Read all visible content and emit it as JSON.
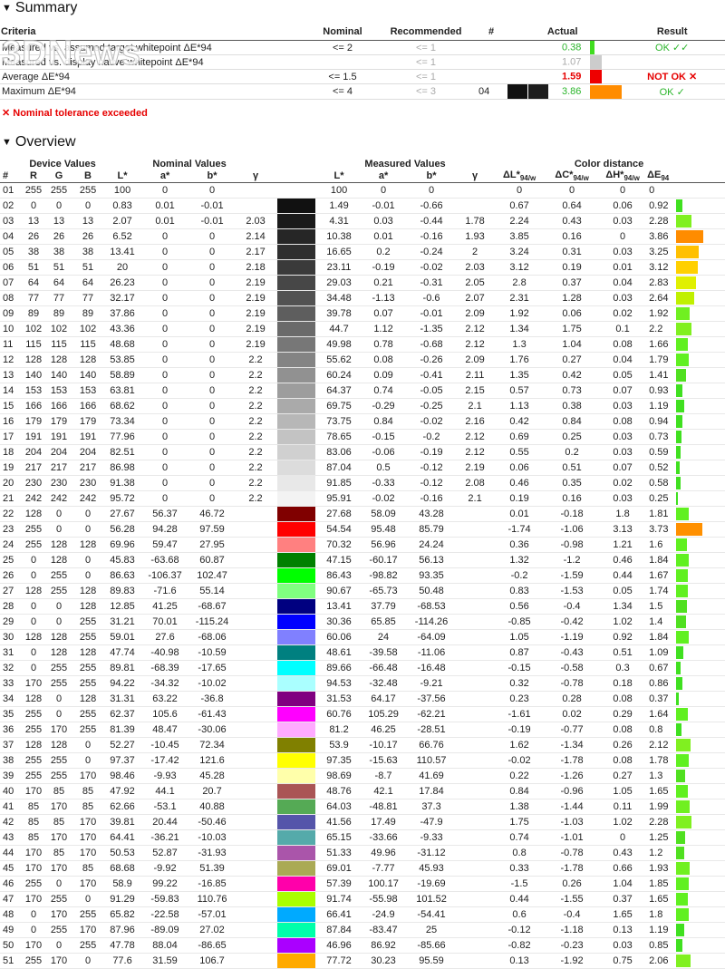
{
  "summary": {
    "title": "Summary",
    "headers": {
      "criteria": "Criteria",
      "nominal": "Nominal",
      "recommended": "Recommended",
      "hash": "#",
      "actual": "Actual",
      "result": "Result"
    },
    "rows": [
      {
        "criteria": "Measured vs. assumed target whitepoint ΔE*94",
        "nominal": "<= 2",
        "recommended": "<= 1",
        "num": "",
        "actual": "0.38",
        "actual_class": "grn",
        "bar_color": "#40dd20",
        "bar_w": "5",
        "result": "OK ✓✓",
        "result_class": "grn"
      },
      {
        "criteria": "Measured vs. display native whitepoint ΔE*94",
        "nominal": "",
        "recommended": "<= 1",
        "num": "",
        "actual": "1.07",
        "actual_class": "gry",
        "bar_color": "#cccccc",
        "bar_w": "13",
        "result": "",
        "result_class": ""
      },
      {
        "criteria": "Average ΔE*94",
        "nominal": "<= 1.5",
        "recommended": "<= 1",
        "num": "",
        "actual": "1.59",
        "actual_class": "red",
        "bar_color": "#ee0000",
        "bar_w": "13",
        "result": "NOT OK ✕",
        "result_class": "red"
      },
      {
        "criteria": "Maximum ΔE*94",
        "nominal": "<= 4",
        "recommended": "<= 3",
        "num": "04",
        "actual": "3.86",
        "actual_class": "grn",
        "bar_color": "#ff8c00",
        "bar_w": "35",
        "result": "OK ✓",
        "result_class": "grn"
      }
    ],
    "watermark": "3DNews"
  },
  "warning": "✕ Nominal tolerance exceeded",
  "overview": {
    "title": "Overview",
    "group_headers": {
      "device": "Device Values",
      "nominal": "Nominal Values",
      "measured": "Measured Values",
      "distance": "Color distance"
    },
    "col_headers": {
      "num": "#",
      "r": "R",
      "g": "G",
      "b": "B",
      "L": "L*",
      "a": "a*",
      "bb": "b*",
      "gamma": "γ",
      "mL": "L*",
      "ma": "a*",
      "mb": "b*",
      "mgamma": "γ",
      "dL": "ΔL*",
      "dC": "ΔC*",
      "dH": "ΔH*",
      "sub": "94/w",
      "de": "ΔE",
      "de_sub": "94"
    },
    "rows": [
      [
        "01",
        "255",
        "255",
        "255",
        "100",
        "0",
        "0",
        "",
        "#ffffff",
        "100",
        "0",
        "0",
        "",
        "0",
        "0",
        "0",
        "0",
        "#ffffff",
        0
      ],
      [
        "02",
        "0",
        "0",
        "0",
        "0.83",
        "0.01",
        "-0.01",
        "",
        "#111111",
        "1.49",
        "-0.01",
        "-0.66",
        "",
        "0.67",
        "0.64",
        "0.06",
        "0.92",
        "#40e020",
        7
      ],
      [
        "03",
        "13",
        "13",
        "13",
        "2.07",
        "0.01",
        "-0.01",
        "2.03",
        "#1a1a1a",
        "4.31",
        "0.03",
        "-0.44",
        "1.78",
        "2.24",
        "0.43",
        "0.03",
        "2.28",
        "#80f020",
        17
      ],
      [
        "04",
        "26",
        "26",
        "26",
        "6.52",
        "0",
        "0",
        "2.14",
        "#262626",
        "10.38",
        "0.01",
        "-0.16",
        "1.93",
        "3.85",
        "0.16",
        "0",
        "3.86",
        "#ff8c00",
        30
      ],
      [
        "05",
        "38",
        "38",
        "38",
        "13.41",
        "0",
        "0",
        "2.17",
        "#2f2f2f",
        "16.65",
        "0.2",
        "-0.24",
        "2",
        "3.24",
        "0.31",
        "0.03",
        "3.25",
        "#ffc000",
        25
      ],
      [
        "06",
        "51",
        "51",
        "51",
        "20",
        "0",
        "0",
        "2.18",
        "#3a3a3a",
        "23.11",
        "-0.19",
        "-0.02",
        "2.03",
        "3.12",
        "0.19",
        "0.01",
        "3.12",
        "#ffd000",
        24
      ],
      [
        "07",
        "64",
        "64",
        "64",
        "26.23",
        "0",
        "0",
        "2.19",
        "#474747",
        "29.03",
        "0.21",
        "-0.31",
        "2.05",
        "2.8",
        "0.37",
        "0.04",
        "2.83",
        "#e0f000",
        22
      ],
      [
        "08",
        "77",
        "77",
        "77",
        "32.17",
        "0",
        "0",
        "2.19",
        "#525252",
        "34.48",
        "-1.13",
        "-0.6",
        "2.07",
        "2.31",
        "1.28",
        "0.03",
        "2.64",
        "#c0f000",
        20
      ],
      [
        "09",
        "89",
        "89",
        "89",
        "37.86",
        "0",
        "0",
        "2.19",
        "#5e5e5e",
        "39.78",
        "0.07",
        "-0.01",
        "2.09",
        "1.92",
        "0.06",
        "0.02",
        "1.92",
        "#70f020",
        15
      ],
      [
        "10",
        "102",
        "102",
        "102",
        "43.36",
        "0",
        "0",
        "2.19",
        "#6a6a6a",
        "44.7",
        "1.12",
        "-1.35",
        "2.12",
        "1.34",
        "1.75",
        "0.1",
        "2.2",
        "#80f020",
        17
      ],
      [
        "11",
        "115",
        "115",
        "115",
        "48.68",
        "0",
        "0",
        "2.19",
        "#777777",
        "49.98",
        "0.78",
        "-0.68",
        "2.12",
        "1.3",
        "1.04",
        "0.08",
        "1.66",
        "#60f020",
        13
      ],
      [
        "12",
        "128",
        "128",
        "128",
        "53.85",
        "0",
        "0",
        "2.2",
        "#848484",
        "55.62",
        "0.08",
        "-0.26",
        "2.09",
        "1.76",
        "0.27",
        "0.04",
        "1.79",
        "#60f020",
        14
      ],
      [
        "13",
        "140",
        "140",
        "140",
        "58.89",
        "0",
        "0",
        "2.2",
        "#919191",
        "60.24",
        "0.09",
        "-0.41",
        "2.11",
        "1.35",
        "0.42",
        "0.05",
        "1.41",
        "#50e020",
        11
      ],
      [
        "14",
        "153",
        "153",
        "153",
        "63.81",
        "0",
        "0",
        "2.2",
        "#9d9d9d",
        "64.37",
        "0.74",
        "-0.05",
        "2.15",
        "0.57",
        "0.73",
        "0.07",
        "0.93",
        "#40e020",
        7
      ],
      [
        "15",
        "166",
        "166",
        "166",
        "68.62",
        "0",
        "0",
        "2.2",
        "#aaaaaa",
        "69.75",
        "-0.29",
        "-0.25",
        "2.1",
        "1.13",
        "0.38",
        "0.03",
        "1.19",
        "#40e020",
        9
      ],
      [
        "16",
        "179",
        "179",
        "179",
        "73.34",
        "0",
        "0",
        "2.2",
        "#b7b7b7",
        "73.75",
        "0.84",
        "-0.02",
        "2.16",
        "0.42",
        "0.84",
        "0.08",
        "0.94",
        "#40e020",
        7
      ],
      [
        "17",
        "191",
        "191",
        "191",
        "77.96",
        "0",
        "0",
        "2.2",
        "#c3c3c3",
        "78.65",
        "-0.15",
        "-0.2",
        "2.12",
        "0.69",
        "0.25",
        "0.03",
        "0.73",
        "#40e020",
        6
      ],
      [
        "18",
        "204",
        "204",
        "204",
        "82.51",
        "0",
        "0",
        "2.2",
        "#d0d0d0",
        "83.06",
        "-0.06",
        "-0.19",
        "2.12",
        "0.55",
        "0.2",
        "0.03",
        "0.59",
        "#40e020",
        5
      ],
      [
        "19",
        "217",
        "217",
        "217",
        "86.98",
        "0",
        "0",
        "2.2",
        "#dcdcdc",
        "87.04",
        "0.5",
        "-0.12",
        "2.19",
        "0.06",
        "0.51",
        "0.07",
        "0.52",
        "#40e020",
        4
      ],
      [
        "20",
        "230",
        "230",
        "230",
        "91.38",
        "0",
        "0",
        "2.2",
        "#e8e8e8",
        "91.85",
        "-0.33",
        "-0.12",
        "2.08",
        "0.46",
        "0.35",
        "0.02",
        "0.58",
        "#40e020",
        5
      ],
      [
        "21",
        "242",
        "242",
        "242",
        "95.72",
        "0",
        "0",
        "2.2",
        "#f3f3f3",
        "95.91",
        "-0.02",
        "-0.16",
        "2.1",
        "0.19",
        "0.16",
        "0.03",
        "0.25",
        "#40e020",
        2
      ],
      [
        "22",
        "128",
        "0",
        "0",
        "27.67",
        "56.37",
        "46.72",
        "",
        "#800000",
        "27.68",
        "58.09",
        "43.28",
        "",
        "0.01",
        "-0.18",
        "1.8",
        "1.81",
        "#60f020",
        14
      ],
      [
        "23",
        "255",
        "0",
        "0",
        "56.28",
        "94.28",
        "97.59",
        "",
        "#ff0000",
        "54.54",
        "95.48",
        "85.79",
        "",
        "-1.74",
        "-1.06",
        "3.13",
        "3.73",
        "#ff9000",
        29
      ],
      [
        "24",
        "255",
        "128",
        "128",
        "69.96",
        "59.47",
        "27.95",
        "",
        "#ff8080",
        "70.32",
        "56.96",
        "24.24",
        "",
        "0.36",
        "-0.98",
        "1.21",
        "1.6",
        "#60f020",
        12
      ],
      [
        "25",
        "0",
        "128",
        "0",
        "45.83",
        "-63.68",
        "60.87",
        "",
        "#008000",
        "47.15",
        "-60.17",
        "56.13",
        "",
        "1.32",
        "-1.2",
        "0.46",
        "1.84",
        "#60f020",
        14
      ],
      [
        "26",
        "0",
        "255",
        "0",
        "86.63",
        "-106.37",
        "102.47",
        "",
        "#00ff00",
        "86.43",
        "-98.82",
        "93.35",
        "",
        "-0.2",
        "-1.59",
        "0.44",
        "1.67",
        "#60f020",
        13
      ],
      [
        "27",
        "128",
        "255",
        "128",
        "89.83",
        "-71.6",
        "55.14",
        "",
        "#80ff80",
        "90.67",
        "-65.73",
        "50.48",
        "",
        "0.83",
        "-1.53",
        "0.05",
        "1.74",
        "#60f020",
        13
      ],
      [
        "28",
        "0",
        "0",
        "128",
        "12.85",
        "41.25",
        "-68.67",
        "",
        "#000080",
        "13.41",
        "37.79",
        "-68.53",
        "",
        "0.56",
        "-0.4",
        "1.34",
        "1.5",
        "#50e020",
        12
      ],
      [
        "29",
        "0",
        "0",
        "255",
        "31.21",
        "70.01",
        "-115.24",
        "",
        "#0000ff",
        "30.36",
        "65.85",
        "-114.26",
        "",
        "-0.85",
        "-0.42",
        "1.02",
        "1.4",
        "#50e020",
        11
      ],
      [
        "30",
        "128",
        "128",
        "255",
        "59.01",
        "27.6",
        "-68.06",
        "",
        "#8080ff",
        "60.06",
        "24",
        "-64.09",
        "",
        "1.05",
        "-1.19",
        "0.92",
        "1.84",
        "#60f020",
        14
      ],
      [
        "31",
        "0",
        "128",
        "128",
        "47.74",
        "-40.98",
        "-10.59",
        "",
        "#008080",
        "48.61",
        "-39.58",
        "-11.06",
        "",
        "0.87",
        "-0.43",
        "0.51",
        "1.09",
        "#40e020",
        8
      ],
      [
        "32",
        "0",
        "255",
        "255",
        "89.81",
        "-68.39",
        "-17.65",
        "",
        "#00ffff",
        "89.66",
        "-66.48",
        "-16.48",
        "",
        "-0.15",
        "-0.58",
        "0.3",
        "0.67",
        "#40e020",
        5
      ],
      [
        "33",
        "170",
        "255",
        "255",
        "94.22",
        "-34.32",
        "-10.02",
        "",
        "#aaffff",
        "94.53",
        "-32.48",
        "-9.21",
        "",
        "0.32",
        "-0.78",
        "0.18",
        "0.86",
        "#40e020",
        7
      ],
      [
        "34",
        "128",
        "0",
        "128",
        "31.31",
        "63.22",
        "-36.8",
        "",
        "#800080",
        "31.53",
        "64.17",
        "-37.56",
        "",
        "0.23",
        "0.28",
        "0.08",
        "0.37",
        "#40e020",
        3
      ],
      [
        "35",
        "255",
        "0",
        "255",
        "62.37",
        "105.6",
        "-61.43",
        "",
        "#ff00ff",
        "60.76",
        "105.29",
        "-62.21",
        "",
        "-1.61",
        "0.02",
        "0.29",
        "1.64",
        "#60f020",
        13
      ],
      [
        "36",
        "255",
        "170",
        "255",
        "81.39",
        "48.47",
        "-30.06",
        "",
        "#ffaaff",
        "81.2",
        "46.25",
        "-28.51",
        "",
        "-0.19",
        "-0.77",
        "0.08",
        "0.8",
        "#40e020",
        6
      ],
      [
        "37",
        "128",
        "128",
        "0",
        "52.27",
        "-10.45",
        "72.34",
        "",
        "#808000",
        "53.9",
        "-10.17",
        "66.76",
        "",
        "1.62",
        "-1.34",
        "0.26",
        "2.12",
        "#80f020",
        16
      ],
      [
        "38",
        "255",
        "255",
        "0",
        "97.37",
        "-17.42",
        "121.6",
        "",
        "#ffff00",
        "97.35",
        "-15.63",
        "110.57",
        "",
        "-0.02",
        "-1.78",
        "0.08",
        "1.78",
        "#60f020",
        14
      ],
      [
        "39",
        "255",
        "255",
        "170",
        "98.46",
        "-9.93",
        "45.28",
        "",
        "#ffffaa",
        "98.69",
        "-8.7",
        "41.69",
        "",
        "0.22",
        "-1.26",
        "0.27",
        "1.3",
        "#50e020",
        10
      ],
      [
        "40",
        "170",
        "85",
        "85",
        "47.92",
        "44.1",
        "20.7",
        "",
        "#aa5555",
        "48.76",
        "42.1",
        "17.84",
        "",
        "0.84",
        "-0.96",
        "1.05",
        "1.65",
        "#60f020",
        13
      ],
      [
        "41",
        "85",
        "170",
        "85",
        "62.66",
        "-53.1",
        "40.88",
        "",
        "#55aa55",
        "64.03",
        "-48.81",
        "37.3",
        "",
        "1.38",
        "-1.44",
        "0.11",
        "1.99",
        "#70f020",
        15
      ],
      [
        "42",
        "85",
        "85",
        "170",
        "39.81",
        "20.44",
        "-50.46",
        "",
        "#5555aa",
        "41.56",
        "17.49",
        "-47.9",
        "",
        "1.75",
        "-1.03",
        "1.02",
        "2.28",
        "#80f020",
        17
      ],
      [
        "43",
        "85",
        "170",
        "170",
        "64.41",
        "-36.21",
        "-10.03",
        "",
        "#55aaaa",
        "65.15",
        "-33.66",
        "-9.33",
        "",
        "0.74",
        "-1.01",
        "0",
        "1.25",
        "#50e020",
        10
      ],
      [
        "44",
        "170",
        "85",
        "170",
        "50.53",
        "52.87",
        "-31.93",
        "",
        "#aa55aa",
        "51.33",
        "49.96",
        "-31.12",
        "",
        "0.8",
        "-0.78",
        "0.43",
        "1.2",
        "#50e020",
        9
      ],
      [
        "45",
        "170",
        "170",
        "85",
        "68.68",
        "-9.92",
        "51.39",
        "",
        "#aaaa55",
        "69.01",
        "-7.77",
        "45.93",
        "",
        "0.33",
        "-1.78",
        "0.66",
        "1.93",
        "#70f020",
        15
      ],
      [
        "46",
        "255",
        "0",
        "170",
        "58.9",
        "99.22",
        "-16.85",
        "",
        "#ff00aa",
        "57.39",
        "100.17",
        "-19.69",
        "",
        "-1.5",
        "0.26",
        "1.04",
        "1.85",
        "#60f020",
        14
      ],
      [
        "47",
        "170",
        "255",
        "0",
        "91.29",
        "-59.83",
        "110.76",
        "",
        "#aaff00",
        "91.74",
        "-55.98",
        "101.52",
        "",
        "0.44",
        "-1.55",
        "0.37",
        "1.65",
        "#60f020",
        13
      ],
      [
        "48",
        "0",
        "170",
        "255",
        "65.82",
        "-22.58",
        "-57.01",
        "",
        "#00aaff",
        "66.41",
        "-24.9",
        "-54.41",
        "",
        "0.6",
        "-0.4",
        "1.65",
        "1.8",
        "#60f020",
        14
      ],
      [
        "49",
        "0",
        "255",
        "170",
        "87.96",
        "-89.09",
        "27.02",
        "",
        "#00ffaa",
        "87.84",
        "-83.47",
        "25",
        "",
        "-0.12",
        "-1.18",
        "0.13",
        "1.19",
        "#40e020",
        9
      ],
      [
        "50",
        "170",
        "0",
        "255",
        "47.78",
        "88.04",
        "-86.65",
        "",
        "#aa00ff",
        "46.96",
        "86.92",
        "-85.66",
        "",
        "-0.82",
        "-0.23",
        "0.03",
        "0.85",
        "#40e020",
        7
      ],
      [
        "51",
        "255",
        "170",
        "0",
        "77.6",
        "31.59",
        "106.7",
        "",
        "#ffaa00",
        "77.72",
        "30.23",
        "95.59",
        "",
        "0.13",
        "-1.92",
        "0.75",
        "2.06",
        "#80f020",
        16
      ]
    ]
  }
}
